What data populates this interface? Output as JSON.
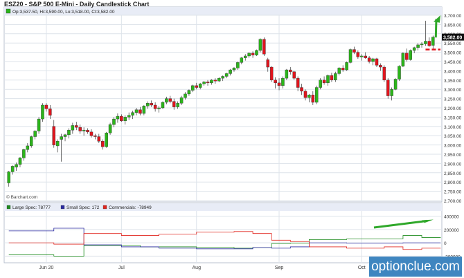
{
  "header": {
    "title": "ESZ20 - S&P 500 E-Mini - Daily Candlestick Chart"
  },
  "brand": {
    "watermark": "optionclue.com"
  },
  "colors": {
    "up": "#2bb51a",
    "down": "#e0141d",
    "grid": "#dde3ea",
    "panel_header": "#e8ecf6",
    "large_spec": "#1e8c1e",
    "small_spec": "#2a2aa0",
    "commercials": "#e0241d",
    "annotation_arrow": "#2fa82a",
    "annotation_level": "#e0141d"
  },
  "chart_data": [
    {
      "type": "candlestick",
      "ohlc_legend": "Op:3,537.50, Hi:3,590.00, Lo:3,518.00, Cl:3,582.00",
      "source": "© Barchart.com",
      "last_price_label": "3,582.00",
      "ylim": [
        2700,
        3700
      ],
      "y_ticks": [
        "2,700.00",
        "2,750.00",
        "2,800.00",
        "2,850.00",
        "2,900.00",
        "2,950.00",
        "3,000.00",
        "3,050.00",
        "3,100.00",
        "3,150.00",
        "3,200.00",
        "3,250.00",
        "3,300.00",
        "3,350.00",
        "3,400.00",
        "3,450.00",
        "3,500.00",
        "3,550.00",
        "3,600.00",
        "3,650.00",
        "3,700.00"
      ],
      "x_ticks": [
        "Jun 20",
        "Jul",
        "Aug",
        "Sep",
        "Oct"
      ],
      "candles": [
        [
          2795,
          2860,
          2775,
          2855
        ],
        [
          2855,
          2890,
          2840,
          2885
        ],
        [
          2880,
          2905,
          2860,
          2895
        ],
        [
          2895,
          2935,
          2880,
          2930
        ],
        [
          2930,
          2980,
          2915,
          2975
        ],
        [
          2975,
          3010,
          2960,
          2995
        ],
        [
          2995,
          3050,
          2985,
          3045
        ],
        [
          3045,
          3080,
          3030,
          3075
        ],
        [
          3075,
          3150,
          3060,
          3140
        ],
        [
          3140,
          3225,
          3125,
          3215
        ],
        [
          3215,
          3225,
          3180,
          3195
        ],
        [
          3195,
          3215,
          3140,
          3160
        ],
        [
          3100,
          3135,
          2985,
          3000
        ],
        [
          2995,
          3030,
          2960,
          3020
        ],
        [
          3030,
          3060,
          2910,
          3045
        ],
        [
          3045,
          3060,
          3020,
          3055
        ],
        [
          3055,
          3090,
          3035,
          3080
        ],
        [
          3080,
          3120,
          3060,
          3105
        ],
        [
          3105,
          3125,
          3080,
          3095
        ],
        [
          3095,
          3110,
          3060,
          3075
        ],
        [
          3075,
          3095,
          3050,
          3080
        ],
        [
          3080,
          3090,
          3060,
          3070
        ],
        [
          3070,
          3085,
          3040,
          3050
        ],
        [
          3050,
          3060,
          3030,
          3045
        ],
        [
          3045,
          3060,
          3010,
          3020
        ],
        [
          3020,
          3030,
          2975,
          2990
        ],
        [
          2990,
          3070,
          2985,
          3065
        ],
        [
          3065,
          3120,
          3055,
          3110
        ],
        [
          3110,
          3150,
          3095,
          3140
        ],
        [
          3140,
          3170,
          3120,
          3155
        ],
        [
          3155,
          3165,
          3125,
          3130
        ],
        [
          3130,
          3160,
          3110,
          3150
        ],
        [
          3150,
          3175,
          3135,
          3160
        ],
        [
          3160,
          3185,
          3140,
          3175
        ],
        [
          3175,
          3200,
          3160,
          3190
        ],
        [
          3190,
          3205,
          3160,
          3170
        ],
        [
          3170,
          3215,
          3160,
          3210
        ],
        [
          3210,
          3235,
          3195,
          3225
        ],
        [
          3225,
          3240,
          3205,
          3215
        ],
        [
          3215,
          3230,
          3180,
          3195
        ],
        [
          3195,
          3210,
          3175,
          3200
        ],
        [
          3200,
          3235,
          3195,
          3230
        ],
        [
          3230,
          3260,
          3220,
          3250
        ],
        [
          3250,
          3265,
          3225,
          3235
        ],
        [
          3235,
          3250,
          3190,
          3205
        ],
        [
          3205,
          3235,
          3195,
          3225
        ],
        [
          3225,
          3265,
          3215,
          3255
        ],
        [
          3255,
          3285,
          3245,
          3275
        ],
        [
          3275,
          3300,
          3265,
          3295
        ],
        [
          3295,
          3325,
          3285,
          3320
        ],
        [
          3320,
          3335,
          3300,
          3310
        ],
        [
          3310,
          3335,
          3300,
          3330
        ],
        [
          3330,
          3345,
          3320,
          3340
        ],
        [
          3340,
          3350,
          3320,
          3335
        ],
        [
          3335,
          3355,
          3325,
          3350
        ],
        [
          3350,
          3360,
          3330,
          3345
        ],
        [
          3345,
          3365,
          3340,
          3360
        ],
        [
          3360,
          3375,
          3345,
          3370
        ],
        [
          3370,
          3390,
          3360,
          3385
        ],
        [
          3385,
          3410,
          3375,
          3405
        ],
        [
          3405,
          3420,
          3395,
          3415
        ],
        [
          3415,
          3450,
          3405,
          3445
        ],
        [
          3445,
          3475,
          3435,
          3470
        ],
        [
          3470,
          3490,
          3455,
          3480
        ],
        [
          3480,
          3500,
          3470,
          3495
        ],
        [
          3495,
          3505,
          3470,
          3485
        ],
        [
          3485,
          3515,
          3480,
          3510
        ],
        [
          3510,
          3575,
          3500,
          3570
        ],
        [
          3570,
          3580,
          3480,
          3490
        ],
        [
          3460,
          3470,
          3395,
          3420
        ],
        [
          3420,
          3425,
          3340,
          3350
        ],
        [
          3350,
          3365,
          3305,
          3335
        ],
        [
          3335,
          3360,
          3295,
          3320
        ],
        [
          3320,
          3370,
          3305,
          3360
        ],
        [
          3360,
          3410,
          3350,
          3405
        ],
        [
          3405,
          3420,
          3380,
          3395
        ],
        [
          3395,
          3400,
          3350,
          3360
        ],
        [
          3360,
          3370,
          3290,
          3310
        ],
        [
          3310,
          3330,
          3270,
          3290
        ],
        [
          3290,
          3300,
          3240,
          3255
        ],
        [
          3255,
          3275,
          3230,
          3270
        ],
        [
          3270,
          3290,
          3215,
          3230
        ],
        [
          3230,
          3320,
          3220,
          3310
        ],
        [
          3310,
          3360,
          3300,
          3350
        ],
        [
          3350,
          3370,
          3325,
          3335
        ],
        [
          3335,
          3380,
          3320,
          3375
        ],
        [
          3375,
          3390,
          3340,
          3350
        ],
        [
          3350,
          3395,
          3340,
          3385
        ],
        [
          3385,
          3420,
          3375,
          3415
        ],
        [
          3415,
          3430,
          3395,
          3405
        ],
        [
          3405,
          3450,
          3400,
          3445
        ],
        [
          3445,
          3520,
          3440,
          3515
        ],
        [
          3515,
          3530,
          3490,
          3500
        ],
        [
          3500,
          3510,
          3465,
          3475
        ],
        [
          3475,
          3490,
          3455,
          3480
        ],
        [
          3480,
          3500,
          3465,
          3470
        ],
        [
          3470,
          3480,
          3440,
          3450
        ],
        [
          3450,
          3470,
          3430,
          3465
        ],
        [
          3465,
          3470,
          3420,
          3430
        ],
        [
          3430,
          3440,
          3400,
          3420
        ],
        [
          3420,
          3430,
          3340,
          3350
        ],
        [
          3350,
          3360,
          3250,
          3265
        ],
        [
          3265,
          3310,
          3240,
          3300
        ],
        [
          3300,
          3360,
          3295,
          3355
        ],
        [
          3355,
          3430,
          3345,
          3425
        ],
        [
          3425,
          3500,
          3420,
          3495
        ],
        [
          3495,
          3520,
          3450,
          3460
        ],
        [
          3460,
          3515,
          3455,
          3510
        ],
        [
          3510,
          3530,
          3495,
          3525
        ],
        [
          3525,
          3550,
          3510,
          3540
        ],
        [
          3540,
          3555,
          3525,
          3545
        ],
        [
          3545,
          3670,
          3535,
          3560
        ],
        [
          3560,
          3580,
          3530,
          3535
        ],
        [
          3537.5,
          3590,
          3518,
          3582
        ]
      ],
      "annotations": {
        "up_arrow": true,
        "resistance_level": 3515
      }
    },
    {
      "type": "line",
      "title": "COT",
      "ylim": [
        -300000,
        480000
      ],
      "y_ticks": [
        "400000",
        "200000",
        "0",
        "-200000"
      ],
      "series": [
        {
          "name": "Large Spec: 78777",
          "values": [
            -180000,
            -180000,
            -180000,
            -180000,
            -180000,
            -180000,
            -180000,
            -180000,
            -180000,
            -180000,
            -180000,
            -180000,
            -200000,
            -200000,
            -200000,
            -200000,
            -200000,
            -200000,
            -200000,
            -200000,
            -40000,
            -40000,
            -40000,
            -40000,
            -40000,
            -40000,
            -40000,
            -40000,
            -40000,
            -40000,
            -40000,
            -40000,
            -40000,
            -40000,
            -40000,
            -60000,
            -60000,
            -60000,
            -60000,
            -60000,
            -60000,
            -60000,
            -60000,
            -60000,
            -60000,
            -60000,
            -60000,
            -60000,
            -60000,
            -60000,
            -70000,
            -70000,
            -70000,
            -70000,
            -70000,
            -70000,
            -70000,
            -70000,
            -70000,
            -70000,
            -80000,
            -80000,
            -80000,
            -80000,
            -80000,
            -70000,
            -70000,
            -70000,
            -70000,
            -70000,
            -10000,
            -10000,
            -10000,
            -10000,
            -10000,
            -5000,
            -5000,
            -5000,
            -5000,
            -5000,
            50000,
            50000,
            50000,
            50000,
            50000,
            50000,
            50000,
            50000,
            50000,
            50000,
            60000,
            60000,
            60000,
            60000,
            60000,
            60000,
            60000,
            60000,
            60000,
            60000,
            60000,
            60000,
            60000,
            60000,
            60000,
            110000,
            110000,
            110000,
            110000,
            110000,
            80000,
            80000,
            80000,
            80000,
            80000,
            78777
          ]
        },
        {
          "name": "Small Spec: 172",
          "values": [
            180000,
            180000,
            180000,
            180000,
            180000,
            180000,
            180000,
            180000,
            180000,
            180000,
            180000,
            180000,
            220000,
            220000,
            220000,
            220000,
            220000,
            220000,
            220000,
            220000,
            -30000,
            -30000,
            -30000,
            -30000,
            -30000,
            -30000,
            -30000,
            -30000,
            -30000,
            -30000,
            -60000,
            -60000,
            -60000,
            -60000,
            -60000,
            -60000,
            -60000,
            -60000,
            -60000,
            -60000,
            -80000,
            -80000,
            -80000,
            -80000,
            -80000,
            -80000,
            -80000,
            -80000,
            -80000,
            -80000,
            -90000,
            -90000,
            -90000,
            -90000,
            -90000,
            -90000,
            -90000,
            -90000,
            -90000,
            -90000,
            -90000,
            -90000,
            -90000,
            -90000,
            -90000,
            -70000,
            -70000,
            -70000,
            -70000,
            -70000,
            -80000,
            -80000,
            -80000,
            -80000,
            -80000,
            -60000,
            -60000,
            -60000,
            -60000,
            -60000,
            0,
            0,
            0,
            0,
            0,
            0,
            0,
            0,
            0,
            0,
            -5000,
            -5000,
            -5000,
            -5000,
            -5000,
            -5000,
            -5000,
            -5000,
            -5000,
            -5000,
            -5000,
            -5000,
            -5000,
            -5000,
            -5000,
            0,
            0,
            0,
            0,
            0,
            0,
            0,
            0,
            0,
            0,
            172
          ]
        },
        {
          "name": "Commercials: -78949",
          "values": [
            0,
            0,
            0,
            0,
            0,
            0,
            0,
            0,
            0,
            0,
            0,
            0,
            -20000,
            -20000,
            -20000,
            -20000,
            -20000,
            -20000,
            -20000,
            -20000,
            140000,
            140000,
            140000,
            140000,
            140000,
            140000,
            140000,
            140000,
            140000,
            140000,
            110000,
            110000,
            110000,
            110000,
            110000,
            110000,
            110000,
            110000,
            110000,
            110000,
            130000,
            130000,
            130000,
            130000,
            130000,
            130000,
            130000,
            130000,
            130000,
            130000,
            160000,
            160000,
            160000,
            160000,
            160000,
            160000,
            160000,
            160000,
            160000,
            160000,
            170000,
            170000,
            170000,
            170000,
            170000,
            140000,
            140000,
            140000,
            140000,
            140000,
            40000,
            40000,
            40000,
            40000,
            40000,
            20000,
            20000,
            20000,
            20000,
            20000,
            -60000,
            -60000,
            -60000,
            -60000,
            -60000,
            -60000,
            -60000,
            -60000,
            -60000,
            -60000,
            -80000,
            -80000,
            -80000,
            -80000,
            -80000,
            -80000,
            -80000,
            -80000,
            -80000,
            -80000,
            -60000,
            -60000,
            -60000,
            -60000,
            -60000,
            -100000,
            -100000,
            -100000,
            -100000,
            -100000,
            -80000,
            -80000,
            -80000,
            -80000,
            -80000,
            -78949
          ]
        }
      ]
    }
  ]
}
